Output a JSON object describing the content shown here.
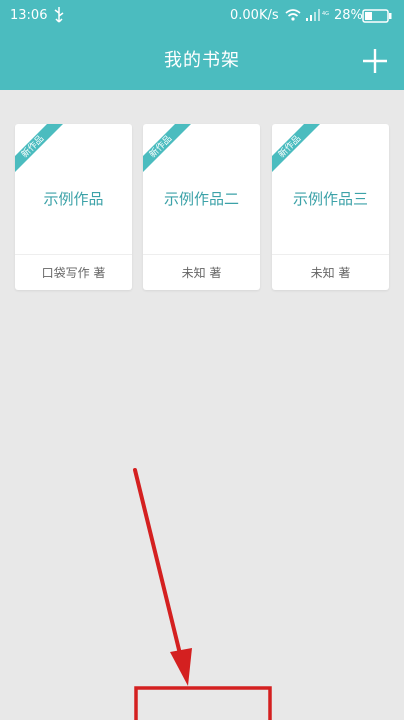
{
  "status_bar": {
    "time": "13:06",
    "net_speed": "0.00K/s",
    "battery": "28%"
  },
  "header": {
    "title": "我的书架",
    "add_icon": "plus-icon"
  },
  "books": [
    {
      "ribbon": "新作品",
      "title": "示例作品",
      "author": "口袋写作 著"
    },
    {
      "ribbon": "新作品",
      "title": "示例作品二",
      "author": "未知 著"
    },
    {
      "ribbon": "新作品",
      "title": "示例作品三",
      "author": "未知 著"
    }
  ],
  "colors": {
    "header_bg": "#4bbcbf",
    "accent": "#3ca2a8",
    "page_bg": "#e8e8e8",
    "annotation": "#d42020"
  }
}
